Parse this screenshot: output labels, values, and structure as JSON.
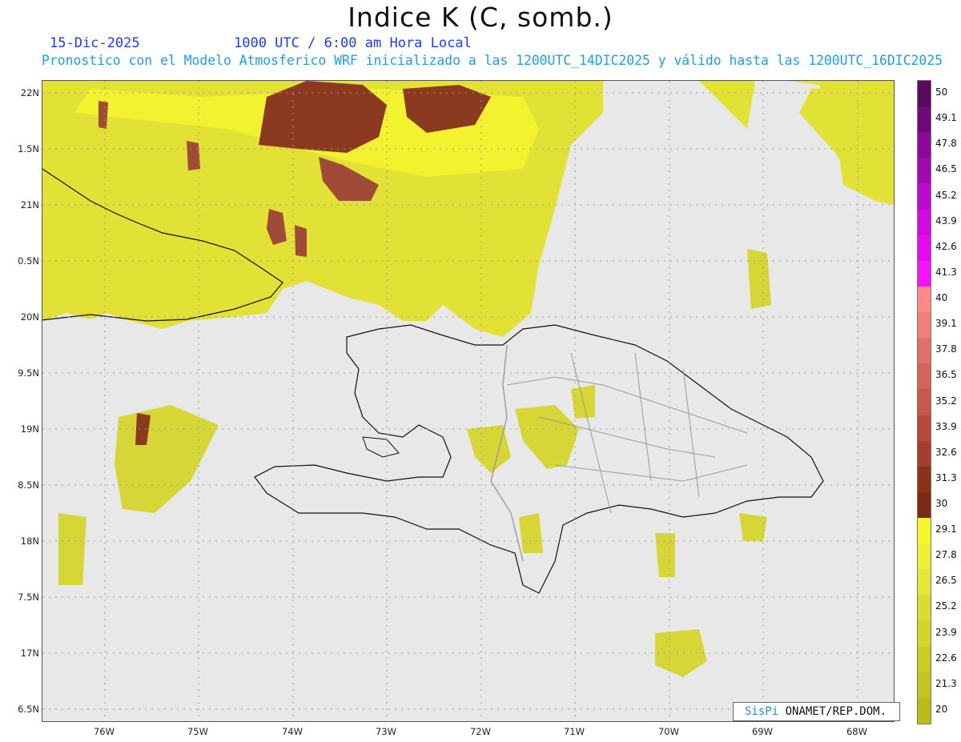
{
  "title": "Indice K (C, somb.)",
  "date": "15-Dic-2025",
  "time": "1000 UTC / 6:00 am Hora Local",
  "description": "Pronostico con el Modelo Atmosferico WRF inicializado a las 1200UTC_14DIC2025 y válido hasta las  1200UTC_16DIC2025",
  "lat_labels": [
    "22N",
    "1.5N",
    "21N",
    "0.5N",
    "20N",
    "9.5N",
    "19N",
    "8.5N",
    "18N",
    "7.5N",
    "17N",
    "6.5N"
  ],
  "lon_labels": [
    "76W",
    "75W",
    "74W",
    "73W",
    "72W",
    "71W",
    "70W",
    "69W",
    "68W"
  ],
  "colorbar": {
    "labels": [
      "50",
      "49.1",
      "47.8",
      "46.5",
      "45.2",
      "43.9",
      "42.6",
      "41.3",
      "40",
      "39.1",
      "37.8",
      "36.5",
      "35.2",
      "33.9",
      "32.6",
      "31.3",
      "30",
      "29.1",
      "27.8",
      "26.5",
      "25.2",
      "23.9",
      "22.6",
      "21.3",
      "20"
    ],
    "colors": [
      "#5a0a5e",
      "#6e0a78",
      "#8a0a96",
      "#a00ab0",
      "#bb0acc",
      "#d00ae0",
      "#e40af0",
      "#f414f8",
      "#ff8a8a",
      "#f08078",
      "#e27068",
      "#d66258",
      "#c8584a",
      "#b84a3a",
      "#a63c2c",
      "#8c3018",
      "#7a2a12",
      "#f6f628",
      "#f0f032",
      "#e6e636",
      "#dcdc30",
      "#d4d42a",
      "#cccc24",
      "#c4c41e",
      "#bcbc18"
    ]
  },
  "credit": {
    "brand": "SisPi",
    "org": " ONAMET/REP.DOM."
  },
  "colors": {
    "background": "#e8e8e8",
    "field_yellow": "#eaea2a",
    "field_olive": "#d6d636",
    "field_brown": "#8b3a20",
    "coast": "#111111",
    "borders": "#9a9a9a"
  }
}
